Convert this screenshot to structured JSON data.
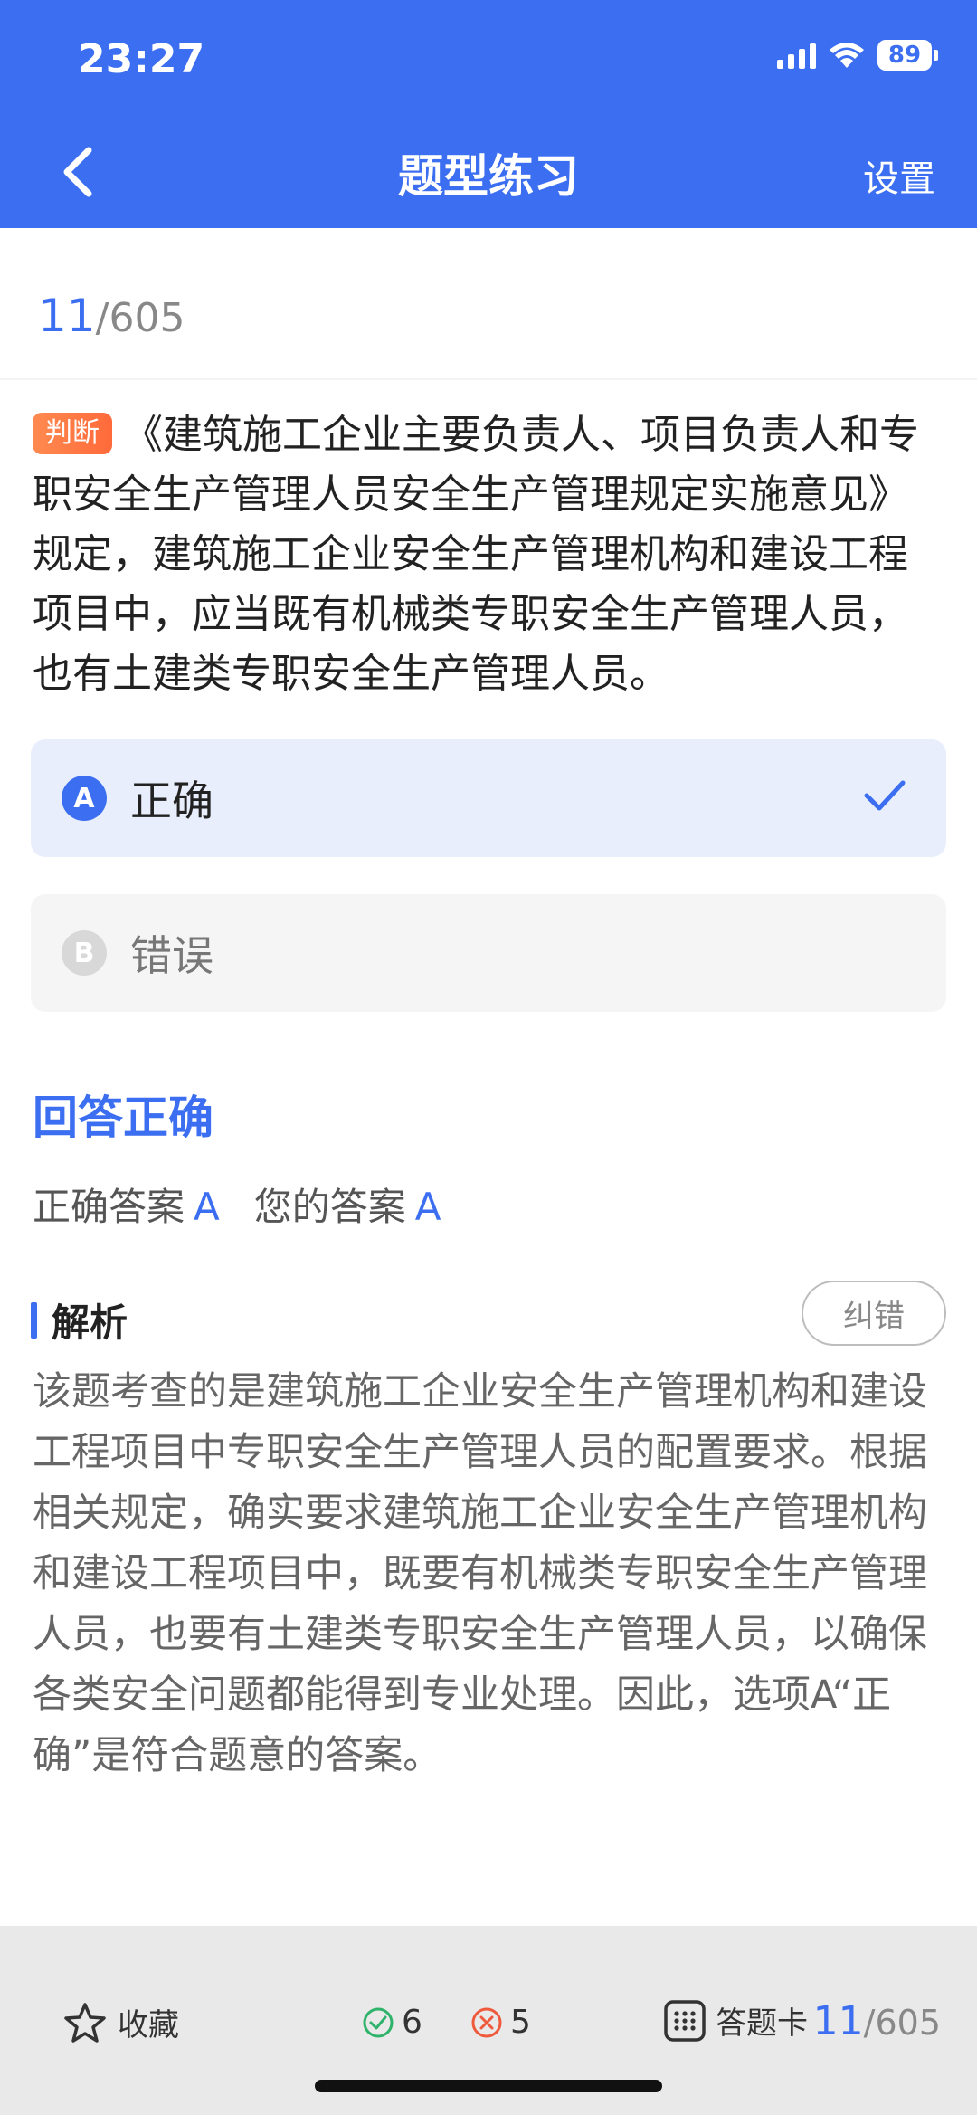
{
  "status_bar": {
    "time": "23:27",
    "battery": "89"
  },
  "header": {
    "title": "题型练习",
    "settings_label": "设置"
  },
  "progress": {
    "current": "11",
    "total": "/605"
  },
  "question": {
    "tag": "判断",
    "text": "《建筑施工企业主要负责人、项目负责人和专职安全生产管理人员安全生产管理规定实施意见》规定，建筑施工企业安全生产管理机构和建设工程项目中，应当既有机械类专职安全生产管理人员，也有土建类专职安全生产管理人员。"
  },
  "options": [
    {
      "letter": "A",
      "text": "正确",
      "selected": true
    },
    {
      "letter": "B",
      "text": "错误",
      "selected": false
    }
  ],
  "result": {
    "title": "回答正确",
    "correct_label": "正确答案",
    "correct_value": "A",
    "yours_label": "您的答案",
    "yours_value": "A"
  },
  "analysis": {
    "title": "解析",
    "report_label": "纠错",
    "text": "该题考查的是建筑施工企业安全生产管理机构和建设工程项目中专职安全生产管理人员的配置要求。根据相关规定，确实要求建筑施工企业安全生产管理机构和建设工程项目中，既要有机械类专职安全生产管理人员，也要有土建类专职安全生产管理人员，以确保各类安全问题都能得到专业处理。因此，选项A“正确”是符合题意的答案。"
  },
  "bottom_bar": {
    "favorite_label": "收藏",
    "correct_count": "6",
    "wrong_count": "5",
    "card_label": "答题卡",
    "current": "11",
    "total": "/605"
  },
  "colors": {
    "accent": "#3b6ef0",
    "tag": "#ff6a3a",
    "ok": "#2fb36b",
    "bad": "#f05a3c"
  }
}
